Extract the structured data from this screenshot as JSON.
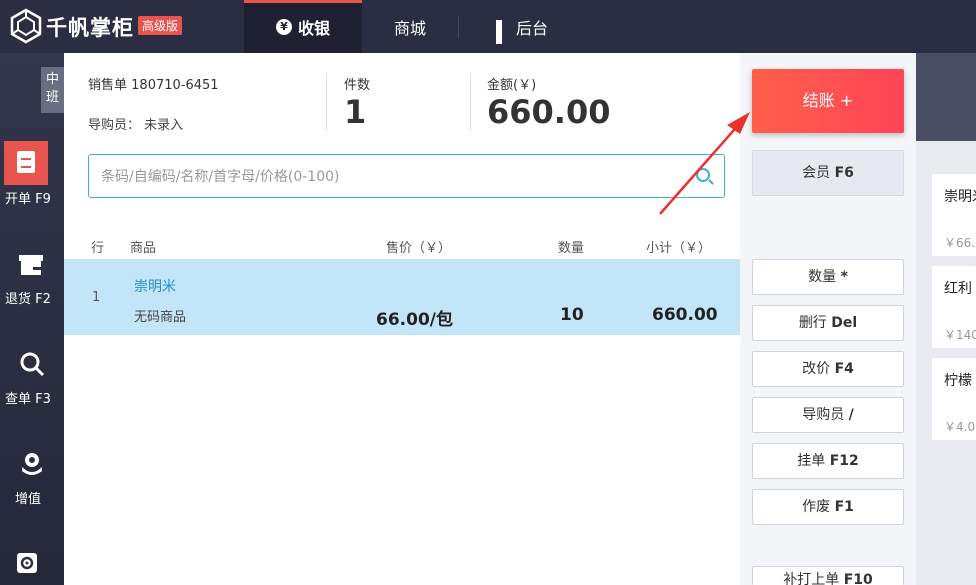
{
  "app": {
    "brand": "千帆掌柜",
    "edition": "高级版"
  },
  "tabs": [
    {
      "label": "收银"
    },
    {
      "label": "商城"
    },
    {
      "label": "后台"
    }
  ],
  "shift": "中班",
  "nav": [
    {
      "label": "开单 F9"
    },
    {
      "label": "退货 F2"
    },
    {
      "label": "查单 F3"
    },
    {
      "label": "增值"
    }
  ],
  "order": {
    "label": "销售单",
    "number": "180710-6451",
    "guide_label": "导购员：",
    "guide_value": "未录入",
    "count_label": "件数",
    "count": "1",
    "amount_label": "金额(￥)",
    "amount": "660.00"
  },
  "search": {
    "placeholder": "条码/自编码/名称/首字母/价格(0-100)"
  },
  "table": {
    "headers": {
      "row": "行",
      "product": "商品",
      "price": "售价（￥）",
      "qty": "数量",
      "subtotal": "小计（￥）"
    },
    "rows": [
      {
        "index": "1",
        "name": "崇明米",
        "sub": "无码商品",
        "price": "66.00/包",
        "qty": "10",
        "subtotal": "660.00"
      }
    ]
  },
  "actions": {
    "pay": "结账 +",
    "vip": "会员",
    "vip_key": "F6",
    "buttons": [
      {
        "label": "数量",
        "key": "*"
      },
      {
        "label": "删行",
        "key": "Del"
      },
      {
        "label": "改价",
        "key": "F4"
      },
      {
        "label": "导购员",
        "key": "/"
      },
      {
        "label": "挂单",
        "key": "F12"
      },
      {
        "label": "作废",
        "key": "F1"
      },
      {
        "label": "补打上单",
        "key": "F10"
      }
    ]
  },
  "products": [
    {
      "name": "崇明米",
      "price": "￥66."
    },
    {
      "name": "红利",
      "price": "￥140"
    },
    {
      "name": "柠檬",
      "price": "￥4.0"
    }
  ],
  "colors": {
    "accent": "#e8554e",
    "row_highlight": "#c2e6f8",
    "search_border": "#3fb0d6"
  }
}
